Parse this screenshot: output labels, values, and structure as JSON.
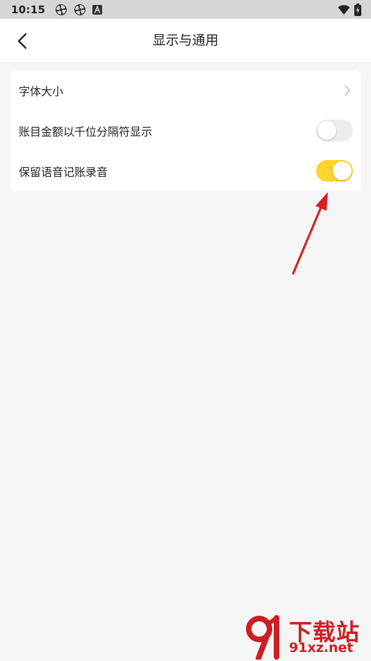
{
  "status_bar": {
    "time": "10:15",
    "icons_left": [
      "pinwheel-icon",
      "pinwheel-icon",
      "a-badge-icon"
    ],
    "icons_right": [
      "wifi-icon",
      "battery-charging-icon"
    ]
  },
  "header": {
    "title": "显示与通用",
    "back_icon": "chevron-left-icon"
  },
  "settings": [
    {
      "label": "字体大小",
      "control": "chevron"
    },
    {
      "label": "账目金额以千位分隔符显示",
      "control": "toggle",
      "on": false
    },
    {
      "label": "保留语音记账录音",
      "control": "toggle",
      "on": true
    }
  ],
  "colors": {
    "toggle_on": "#fdd32d",
    "toggle_off": "#ebebeb",
    "annotation_arrow": "#d81f26",
    "watermark": "#cc1e23"
  },
  "watermark": {
    "logo_text": "91",
    "text_cn": "下载站",
    "text_url": "91xz.net"
  }
}
